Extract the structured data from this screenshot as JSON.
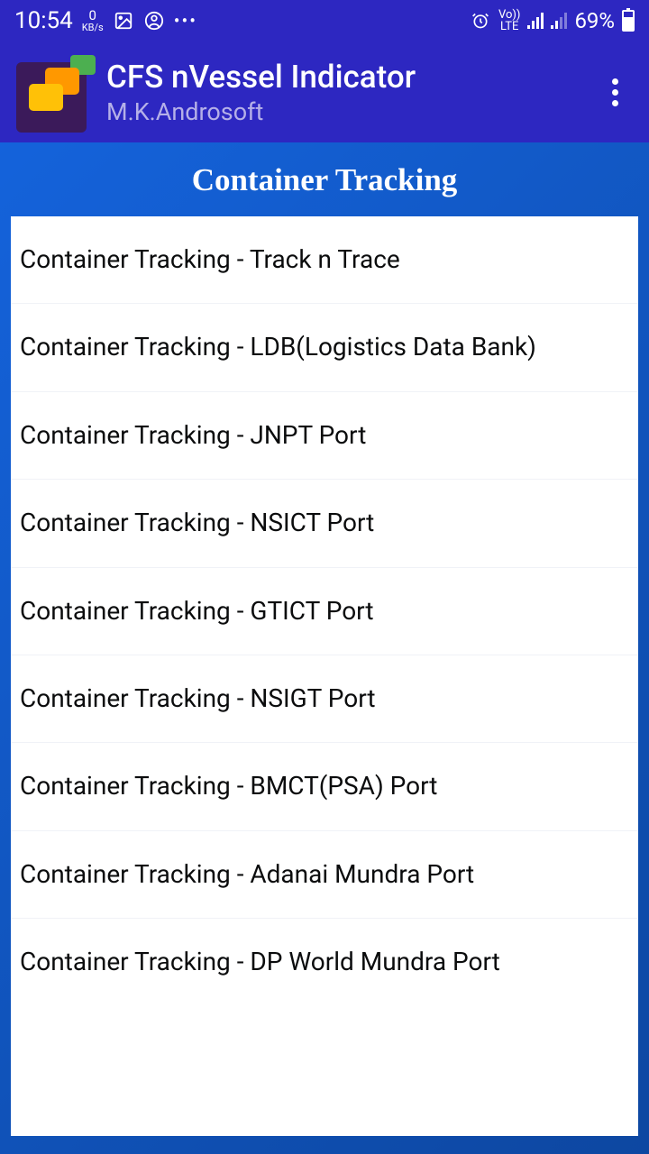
{
  "status": {
    "time": "10:54",
    "kb_value": "0",
    "kb_unit": "KB/s",
    "dots": "•••",
    "lte_top": "Vo))",
    "lte_bottom": "LTE",
    "battery": "69%"
  },
  "appbar": {
    "title": "CFS nVessel Indicator",
    "subtitle": "M.K.Androsoft"
  },
  "page": {
    "title": "Container Tracking"
  },
  "list": {
    "items": [
      {
        "label": "Container Tracking - Track n Trace"
      },
      {
        "label": "Container Tracking - LDB(Logistics Data Bank)"
      },
      {
        "label": "Container Tracking - JNPT Port"
      },
      {
        "label": "Container Tracking - NSICT Port"
      },
      {
        "label": "Container Tracking - GTICT Port"
      },
      {
        "label": "Container Tracking - NSIGT Port"
      },
      {
        "label": "Container Tracking - BMCT(PSA) Port"
      },
      {
        "label": "Container Tracking - Adanai Mundra Port"
      },
      {
        "label": "Container Tracking - DP World Mundra Port"
      }
    ]
  }
}
